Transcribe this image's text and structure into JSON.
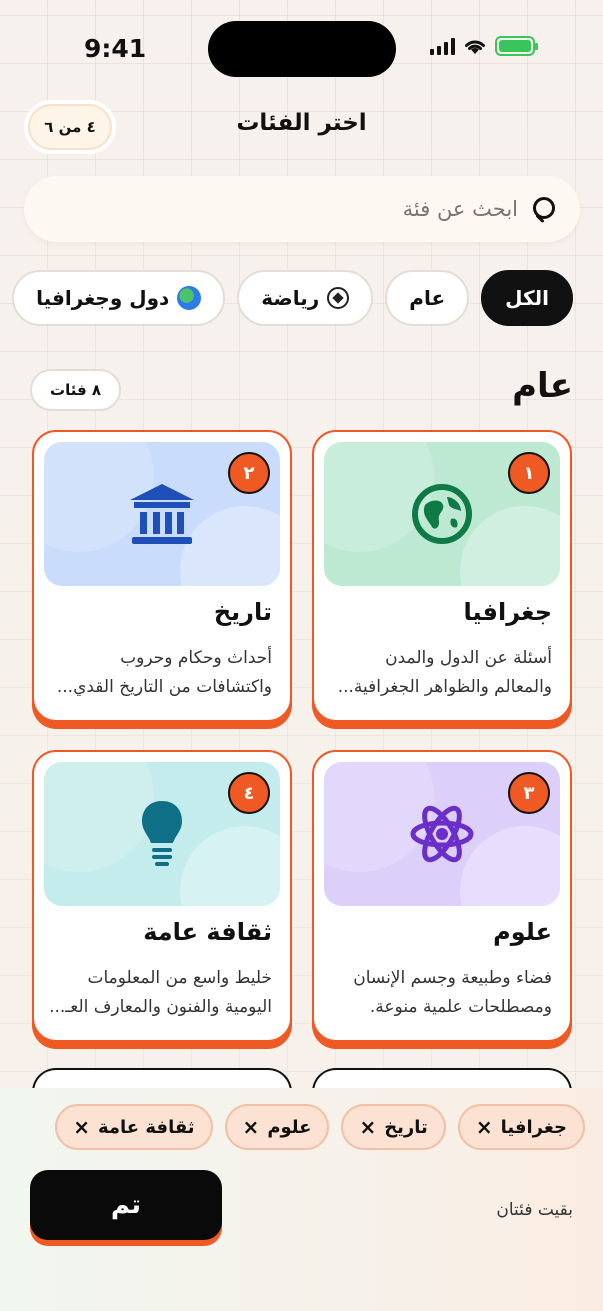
{
  "status_bar": {
    "time": "9:41"
  },
  "header": {
    "title": "اختر الفئات",
    "counter": "٤ من ٦"
  },
  "search": {
    "placeholder": "ابحث عن فئة"
  },
  "filters": [
    {
      "label": "الكل",
      "active": true
    },
    {
      "label": "عام",
      "active": false
    },
    {
      "label": "رياضة",
      "icon": "soccer-ball-icon"
    },
    {
      "label": "دول وجغرافيا",
      "icon": "globe-icon"
    }
  ],
  "section": {
    "title": "عام",
    "count": "٨ فئات"
  },
  "cards": [
    {
      "number": "١",
      "title": "جغرافيا",
      "desc": "أسئلة عن الدول والمدن والمعالم والظواهر الجغرافية...",
      "icon": "earth-icon",
      "color": "#bde9d3"
    },
    {
      "number": "٢",
      "title": "تاريخ",
      "desc": "أحداث وحكام وحروب واكتشافات من التاريخ القدي...",
      "icon": "museum-icon",
      "color": "#c9dcfb"
    },
    {
      "number": "٣",
      "title": "علوم",
      "desc": "فضاء وطبيعة وجسم الإنسان ومصطلحات علمية منوعة.",
      "icon": "atom-icon",
      "color": "#dcd0fb"
    },
    {
      "number": "٤",
      "title": "ثقافة عامة",
      "desc": "خليط واسع من المعلومات اليومية والفنون والمعارف العـ...",
      "icon": "lightbulb-icon",
      "color": "#c5ecec"
    }
  ],
  "selected": {
    "tags": [
      "جغرافيا",
      "تاريخ",
      "علوم",
      "ثقافة عامة"
    ],
    "remaining": "بقيت فئتان",
    "done_label": "تم"
  },
  "colors": {
    "accent": "#ef5a24",
    "dark": "#0a0a0a"
  }
}
